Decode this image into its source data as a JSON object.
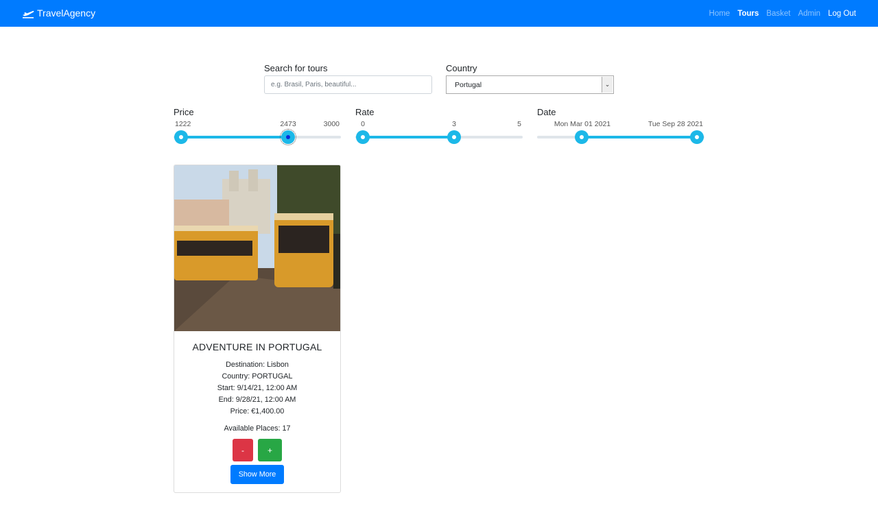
{
  "navbar": {
    "brand": "TravelAgency",
    "brand_icon": "plane-icon",
    "links": [
      "Home",
      "Tours",
      "Basket",
      "Admin",
      "Log Out"
    ],
    "active": "Tours",
    "colors": {
      "background": "#007bff",
      "text": "#ffffff"
    }
  },
  "filters": {
    "search": {
      "label": "Search for tours",
      "placeholder": "e.g. Brasil, Paris, beautiful...",
      "value": ""
    },
    "country": {
      "label": "Country",
      "selected": "Portugal"
    },
    "price": {
      "label": "Price",
      "min": "1222",
      "max": "3000",
      "low": "1222",
      "high": "2473",
      "low_value": 1222,
      "high_value": 2473,
      "range": [
        1222,
        3000
      ],
      "high_label": "2473"
    },
    "rate": {
      "label": "Rate",
      "min": "0",
      "max": "5",
      "high_label": "3",
      "low_value": 0,
      "high_value": 3,
      "range": [
        0,
        5
      ]
    },
    "date": {
      "label": "Date",
      "low_label": "Mon Mar 01 2021",
      "high_label": "Tue Sep 28 2021",
      "low_fraction": 0.27,
      "high_fraction": 0.96
    },
    "slider_color": "#1cb8e8"
  },
  "tours": [
    {
      "image": "lisbon-tram-photo",
      "title": "ADVENTURE IN PORTUGAL",
      "destination": "Destination: Lisbon",
      "country": "Country: PORTUGAL",
      "start": "Start: 9/14/21, 12:00 AM",
      "end": "End: 9/28/21, 12:00 AM",
      "price": "Price: €1,400.00",
      "available": "Available Places: 17",
      "minus_label": "-",
      "plus_label": "+",
      "more_label": "Show More"
    }
  ]
}
